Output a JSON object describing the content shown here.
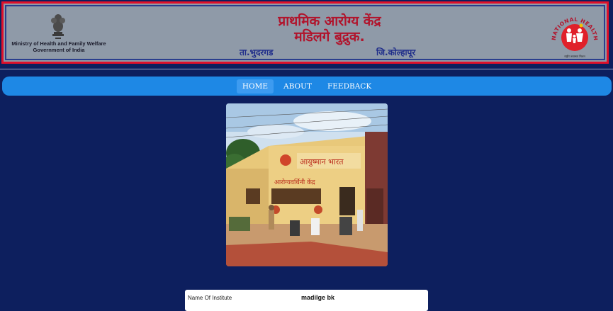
{
  "header": {
    "ministry_line1": "Ministry of Health and Family Welfare",
    "ministry_line2": "Government of India",
    "title_line1": "प्राथमिक आरोग्य केंद्र",
    "title_line2": "मडिलगे बुद्रुक.",
    "taluka": "ता.भुदरगड",
    "district": "जि.कोल्हापूर",
    "nhm_ring_text": "NATIONAL HEALTH MISSION",
    "nhm_caption": "राष्ट्रीय स्वास्थ्य मिशन",
    "emblem_icon": "national-emblem-icon",
    "nhm_icon": "nhm-logo-icon",
    "colors": {
      "border": "#e0102a",
      "title": "#b1142c",
      "sub": "#1f2d8a",
      "banner": "#8f9aa8"
    }
  },
  "nav": {
    "items": [
      {
        "label": "HOME",
        "active": true
      },
      {
        "label": "ABOUT",
        "active": false
      },
      {
        "label": "FEEDBACK",
        "active": false
      }
    ],
    "color": "#1e88e5"
  },
  "photo": {
    "sign_text": "आयुष्मान भारत",
    "sign_text2": "आरोग्यवर्धिनी केंद्र"
  },
  "info": {
    "rows": [
      {
        "label": "Name Of Institute",
        "value": "madilge bk"
      }
    ]
  },
  "page_bg": "#0d1f5e"
}
